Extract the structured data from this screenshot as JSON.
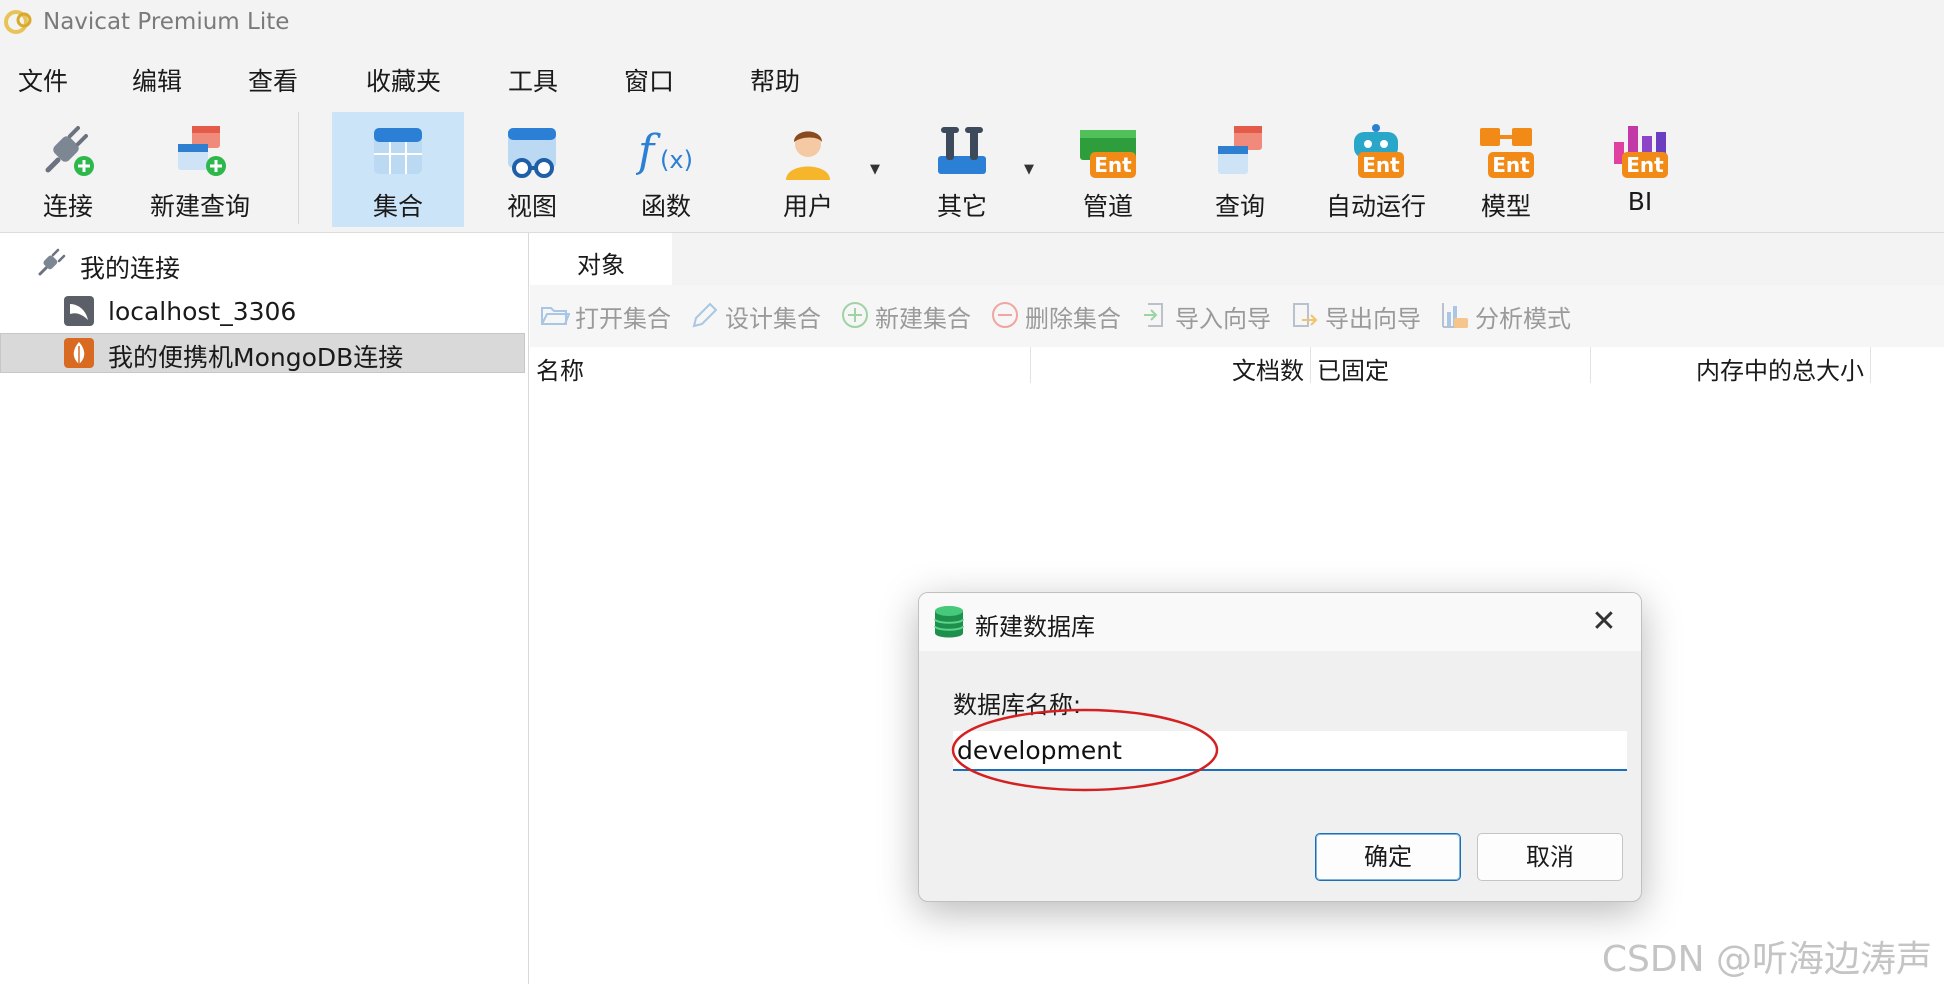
{
  "app": {
    "title": "Navicat Premium Lite"
  },
  "menu": [
    "文件",
    "编辑",
    "查看",
    "收藏夹",
    "工具",
    "窗口",
    "帮助"
  ],
  "toolbar": {
    "connect": "连接",
    "new_query": "新建查询",
    "collection": "集合",
    "view": "视图",
    "function": "函数",
    "user": "用户",
    "other": "其它",
    "pipeline": "管道",
    "query": "查询",
    "automation": "自动运行",
    "model": "模型",
    "bi": "BI",
    "ent_badge": "Ent"
  },
  "tree": {
    "root": "我的连接",
    "items": [
      "localhost_3306",
      "我的便携机MongoDB连接"
    ]
  },
  "tabs": {
    "objects": "对象"
  },
  "object_toolbar": {
    "open": "打开集合",
    "design": "设计集合",
    "new": "新建集合",
    "delete": "删除集合",
    "import": "导入向导",
    "export": "导出向导",
    "analyze": "分析模式"
  },
  "columns": {
    "name": "名称",
    "docs": "文档数",
    "capped": "已固定",
    "size": "内存中的总大小"
  },
  "dialog": {
    "title": "新建数据库",
    "label": "数据库名称:",
    "value": "development",
    "ok": "确定",
    "cancel": "取消",
    "close": "✕"
  },
  "watermark": "CSDN @听海边涛声"
}
